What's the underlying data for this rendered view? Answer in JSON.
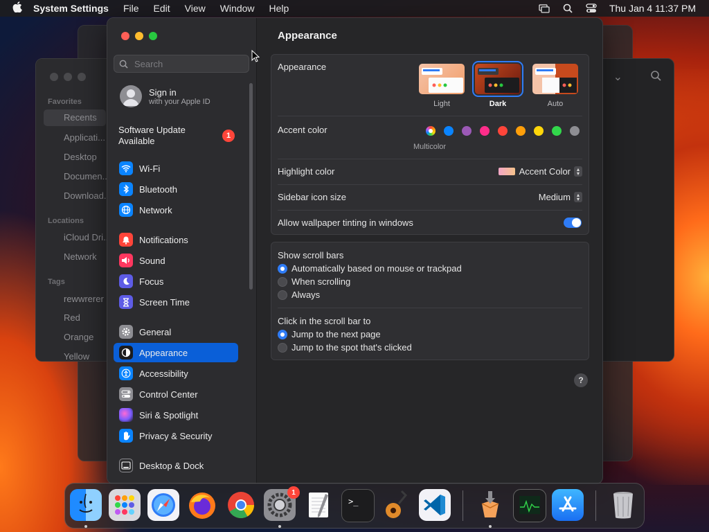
{
  "menubar": {
    "app": "System Settings",
    "items": [
      "File",
      "Edit",
      "View",
      "Window",
      "Help"
    ],
    "clock": "Thu Jan 4  11:37 PM"
  },
  "finder": {
    "favorites_header": "Favorites",
    "favorites": [
      "Recents",
      "Applicati...",
      "Desktop",
      "Documen...",
      "Download..."
    ],
    "locations_header": "Locations",
    "locations": [
      "iCloud Dri...",
      "Network"
    ],
    "tags_header": "Tags",
    "tags": [
      {
        "name": "rewwrerer",
        "color": "#3a3a3d"
      },
      {
        "name": "Red",
        "color": "#3a3a3d"
      },
      {
        "name": "Orange",
        "color": "#3a3a3d"
      },
      {
        "name": "Yellow",
        "color": "#3a3a3d"
      }
    ]
  },
  "sidebar": {
    "search_placeholder": "Search",
    "profile": {
      "title": "Sign in",
      "subtitle": "with your Apple ID"
    },
    "update": {
      "line1": "Software Update",
      "line2": "Available",
      "badge": "1"
    },
    "items": [
      {
        "label": "Wi-Fi",
        "icon": "wifi-icon",
        "color": "#0a84ff"
      },
      {
        "label": "Bluetooth",
        "icon": "bluetooth-icon",
        "color": "#0a84ff"
      },
      {
        "label": "Network",
        "icon": "globe-icon",
        "color": "#0a84ff"
      },
      {
        "label": "Notifications",
        "icon": "bell-icon",
        "color": "#ff453a"
      },
      {
        "label": "Sound",
        "icon": "speaker-icon",
        "color": "#ff375f"
      },
      {
        "label": "Focus",
        "icon": "moon-icon",
        "color": "#5e5ce6"
      },
      {
        "label": "Screen Time",
        "icon": "hourglass-icon",
        "color": "#5e5ce6"
      },
      {
        "label": "General",
        "icon": "gear-icon",
        "color": "#8e8e93"
      },
      {
        "label": "Appearance",
        "icon": "appearance-icon",
        "color": "#1c1c1e"
      },
      {
        "label": "Accessibility",
        "icon": "accessibility-icon",
        "color": "#0a84ff"
      },
      {
        "label": "Control Center",
        "icon": "switches-icon",
        "color": "#8e8e93"
      },
      {
        "label": "Siri & Spotlight",
        "icon": "siri-icon",
        "color": "#bf5af2"
      },
      {
        "label": "Privacy & Security",
        "icon": "hand-icon",
        "color": "#0a84ff"
      },
      {
        "label": "Desktop & Dock",
        "icon": "dock-icon",
        "color": "#2c2c2e"
      }
    ]
  },
  "content": {
    "title": "Appearance",
    "appearance_label": "Appearance",
    "appearance_options": [
      "Light",
      "Dark",
      "Auto"
    ],
    "appearance_selected": "Dark",
    "accent_label": "Accent color",
    "accent_selected_label": "Multicolor",
    "accent_colors": [
      "#0a84ff",
      "#9b59b6",
      "#ff2d8a",
      "#ff453a",
      "#ff9f0a",
      "#ffd60a",
      "#32d74b",
      "#8e8e93"
    ],
    "highlight_label": "Highlight color",
    "highlight_value": "Accent Color",
    "icon_size_label": "Sidebar icon size",
    "icon_size_value": "Medium",
    "tinting_label": "Allow wallpaper tinting in windows",
    "tinting_on": true,
    "scroll_label": "Show scroll bars",
    "scroll_options": [
      "Automatically based on mouse or trackpad",
      "When scrolling",
      "Always"
    ],
    "scroll_selected": 0,
    "click_label": "Click in the scroll bar to",
    "click_options": [
      "Jump to the next page",
      "Jump to the spot that's clicked"
    ],
    "click_selected": 0,
    "help": "?"
  },
  "dock": {
    "apps": [
      "Finder",
      "Launchpad",
      "Safari",
      "Firefox",
      "Chrome",
      "System Settings",
      "TextEdit",
      "Terminal",
      "GarageBand",
      "Visual Studio Code",
      "Installer",
      "Activity Monitor",
      "App Store",
      "Trash"
    ],
    "settings_badge": "1"
  }
}
